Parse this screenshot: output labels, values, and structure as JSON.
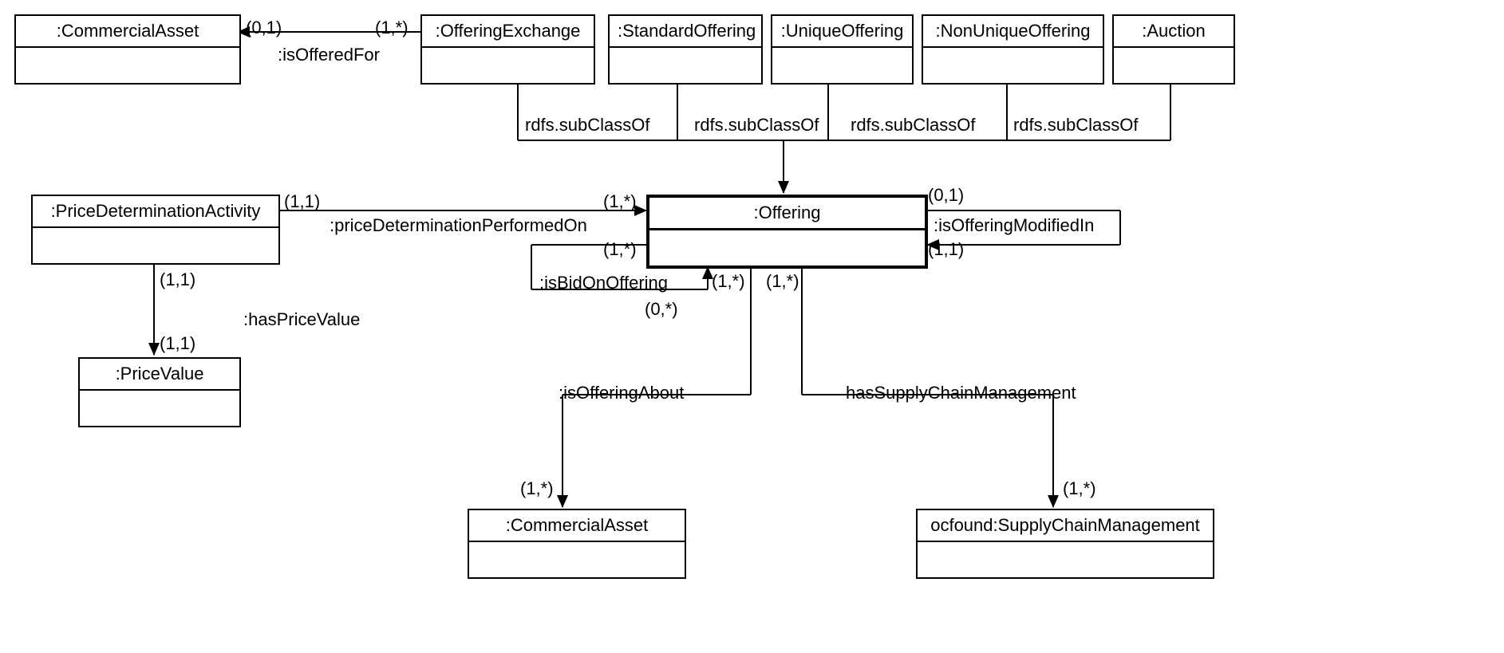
{
  "classes": {
    "commercialAsset1": ":CommercialAsset",
    "offeringExchange": ":OfferingExchange",
    "standardOffering": ":StandardOffering",
    "uniqueOffering": ":UniqueOffering",
    "nonUniqueOffering": ":NonUniqueOffering",
    "auction": ":Auction",
    "priceDeterminationActivity": ":PriceDeterminationActivity",
    "offering": ":Offering",
    "priceValue": ":PriceValue",
    "commercialAsset2": ":CommercialAsset",
    "supplyChainManagement": "ocfound:SupplyChainManagement"
  },
  "relations": {
    "isOfferedFor": ":isOfferedFor",
    "subClassOf1": "rdfs.subClassOf",
    "subClassOf2": "rdfs.subClassOf",
    "subClassOf3": "rdfs.subClassOf",
    "subClassOf4": "rdfs.subClassOf",
    "priceDeterminationPerformedOn": ":priceDeterminationPerformedOn",
    "isOfferingModifiedIn": ":isOfferingModifiedIn",
    "isBidOnOffering": ":isBidOnOffering",
    "hasPriceValue": ":hasPriceValue",
    "isOfferingAbout": ":isOfferingAbout",
    "hasSupplyChainManagement": "hasSupplyChainManagement"
  },
  "card": {
    "c01a": "(0,1)",
    "c1s": "(1,*)",
    "c11": "(1,1)",
    "c0s": "(0,*)"
  }
}
